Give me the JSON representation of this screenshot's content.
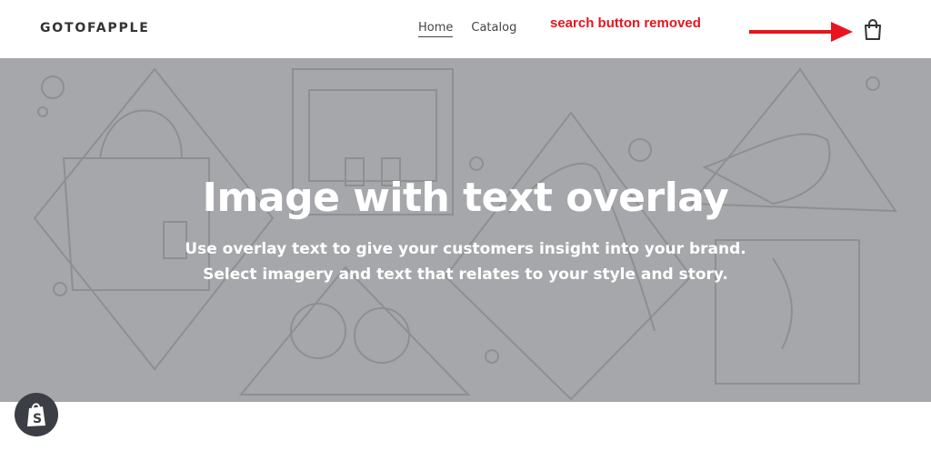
{
  "header": {
    "logo": "GOTOFAPPLE",
    "nav": [
      {
        "label": "Home",
        "active": true
      },
      {
        "label": "Catalog",
        "active": false
      }
    ],
    "annotation": "search button removed",
    "annotation_color": "#e8141f",
    "cart_icon": "shopping-bag-icon"
  },
  "hero": {
    "title": "Image with text overlay",
    "subtitle_line1": "Use overlay text to give your customers insight into your brand.",
    "subtitle_line2": "Select imagery and text that relates to your style and story.",
    "overlay_color": "#a6a7aa"
  },
  "shopify_badge": {
    "icon": "shopify-bag-icon"
  }
}
